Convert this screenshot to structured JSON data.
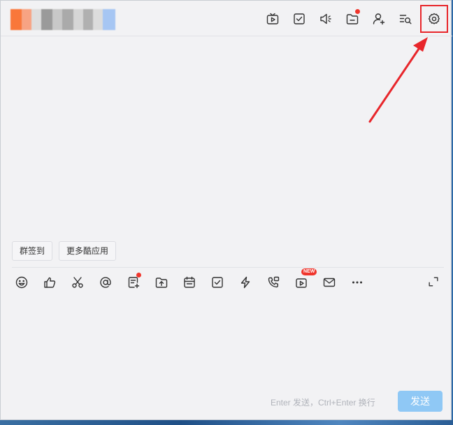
{
  "header": {
    "title_blur_colors": [
      "#f9773a",
      "#f7a383",
      "#dedede",
      "#9a9a9a",
      "#c8c8c8",
      "#aaaaaa",
      "#d6d6d6",
      "#b0b0b0",
      "#dcdcdc",
      "#a6c6f3"
    ],
    "icons": [
      {
        "name": "tv-play-icon"
      },
      {
        "name": "task-check-icon"
      },
      {
        "name": "announcement-icon"
      },
      {
        "name": "folder-icon",
        "dot": true
      },
      {
        "name": "add-member-icon"
      },
      {
        "name": "search-history-icon"
      },
      {
        "name": "settings-gear-icon",
        "highlighted": true
      }
    ]
  },
  "apps": {
    "sign_in": "群签到",
    "more_apps": "更多酷应用"
  },
  "toolbar": {
    "new_badge": "NEW",
    "tools": [
      "emoji-icon",
      "thumbs-up-icon",
      "scissors-icon",
      "at-icon",
      "doc-add-icon",
      "upload-file-icon",
      "calendar-icon",
      "todo-check-icon",
      "lightning-icon",
      "phone-video-icon",
      "live-play-icon",
      "mail-icon",
      "more-dots-icon"
    ]
  },
  "input": {
    "hint": "Enter 发送，Ctrl+Enter 换行",
    "send_label": "发送"
  },
  "colors": {
    "highlight": "#e8262b",
    "annotation_arrow": "#e8262b",
    "send_disabled": "#8fc8f5",
    "badge_red": "#f0352c"
  }
}
